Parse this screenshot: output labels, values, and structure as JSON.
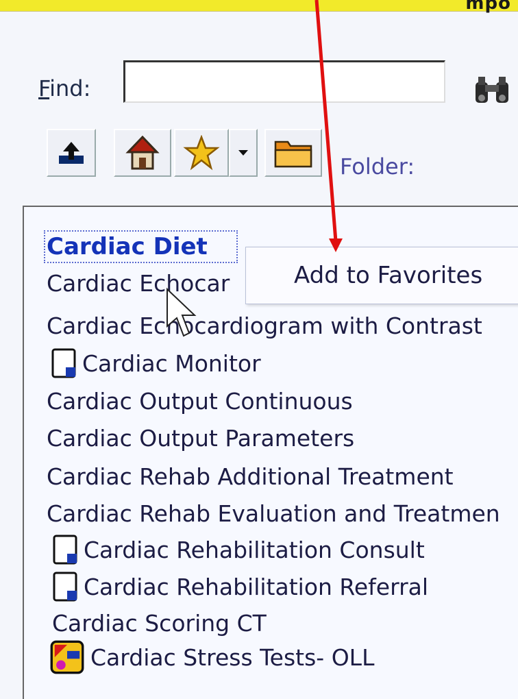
{
  "header": {
    "title_fragment": "mpo"
  },
  "find": {
    "label_prefix": "F",
    "label_rest": "ind:",
    "value": ""
  },
  "toolbar": {
    "up_icon": "up-folder-icon",
    "home_icon": "home-icon",
    "favorites_icon": "star-icon",
    "dropdown_icon": "dropdown-arrow-icon",
    "folder_icon": "folder-icon",
    "folder_label": "Folder:"
  },
  "context_menu": {
    "item": "Add to Favorites"
  },
  "list": {
    "items": [
      {
        "label": "Cardiac Diet",
        "icon": "none"
      },
      {
        "label": "Cardiac Echocar",
        "icon": "none"
      },
      {
        "label": "Cardiac Echocardiogram with Contrast",
        "icon": "none"
      },
      {
        "label": "Cardiac Monitor",
        "icon": "document-icon"
      },
      {
        "label": "Cardiac Output Continuous",
        "icon": "none"
      },
      {
        "label": "Cardiac Output Parameters",
        "icon": "none"
      },
      {
        "label": "Cardiac Rehab Additional Treatment",
        "icon": "none"
      },
      {
        "label": "Cardiac Rehab Evaluation and Treatmen",
        "icon": "none"
      },
      {
        "label": "Cardiac Rehabilitation Consult",
        "icon": "document-icon"
      },
      {
        "label": "Cardiac Rehabilitation Referral",
        "icon": "document-icon"
      },
      {
        "label": "Cardiac Scoring CT",
        "icon": "none"
      },
      {
        "label": "Cardiac Stress Tests- OLL",
        "icon": "order-set-icon"
      }
    ]
  },
  "colors": {
    "accent": "#f2ea2a",
    "selected": "#1433b8",
    "arrow": "#e01010"
  }
}
